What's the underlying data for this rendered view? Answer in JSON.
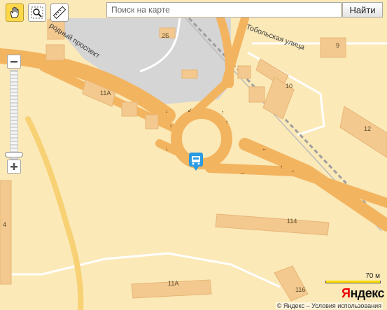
{
  "toolbar": {
    "pan_tool": "hand-icon",
    "zoom_tool": "magnifier-icon",
    "ruler_tool": "ruler-icon"
  },
  "search": {
    "placeholder": "Поиск на карте",
    "value": "",
    "button_label": "Найти"
  },
  "zoom": {
    "plus": "+",
    "minus": "−"
  },
  "map": {
    "streets": [
      "родный проспект",
      "Тобольская улица"
    ],
    "buildings": [
      "2Б",
      "9",
      "11А",
      "10",
      "12",
      "4",
      "114",
      "11А",
      "116"
    ],
    "colors": {
      "background": "#fbe9b8",
      "road": "#f3b460",
      "building": "#f3c98f",
      "rail_area": "#d5d5d5",
      "transit": "#2a9be0"
    }
  },
  "scale": {
    "label": "70 м"
  },
  "brand": {
    "logo_ya": "Я",
    "logo_rest": "ндекс",
    "copyright": "© Яндекс – Условия использования"
  }
}
